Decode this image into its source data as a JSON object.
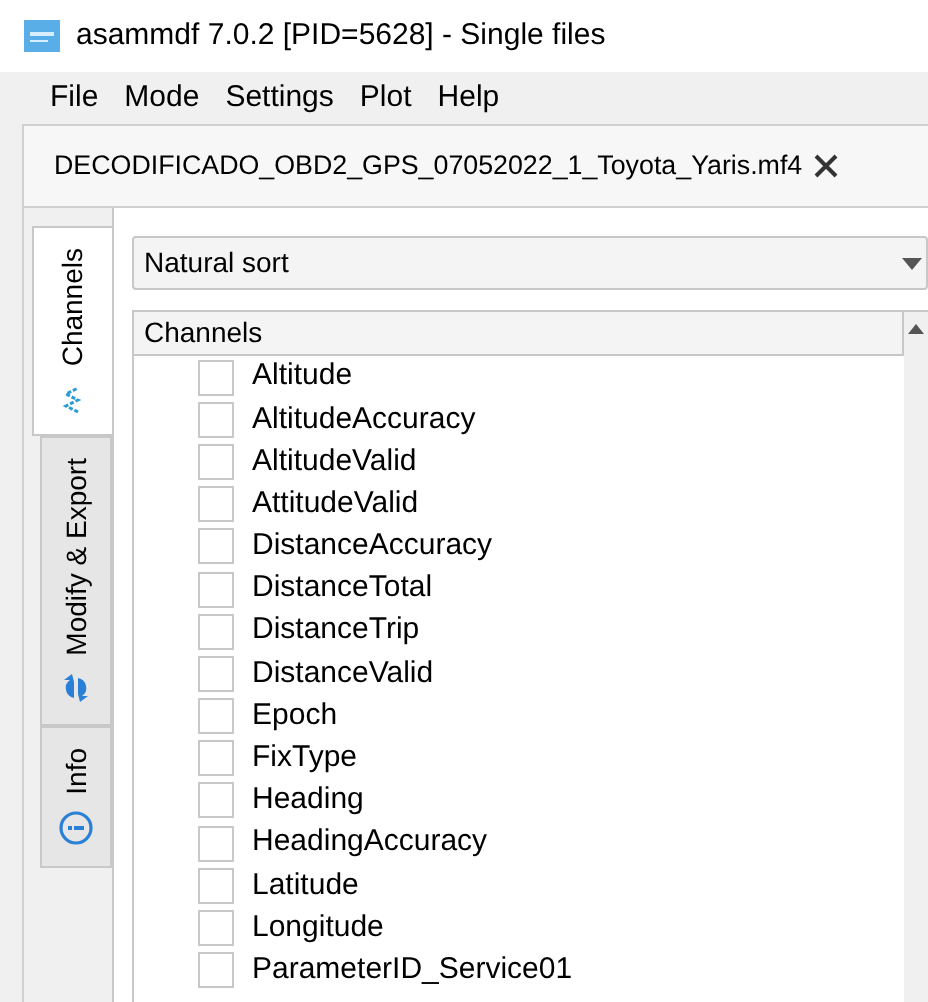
{
  "window": {
    "title": "asammdf 7.0.2 [PID=5628] - Single files"
  },
  "menu": [
    "File",
    "Mode",
    "Settings",
    "Plot",
    "Help"
  ],
  "file_tab": {
    "label": "DECODIFICADO_OBD2_GPS_07052022_1_Toyota_Yaris.mf4"
  },
  "side_tabs": [
    {
      "label": "Channels",
      "selected": true,
      "kind": "channels"
    },
    {
      "label": "Modify & Export",
      "selected": false,
      "kind": "modify"
    },
    {
      "label": "Info",
      "selected": false,
      "kind": "info"
    }
  ],
  "sort_combo": {
    "value": "Natural sort"
  },
  "tree": {
    "header": "Channels",
    "rows": [
      {
        "name": "Altitude",
        "checked": false
      },
      {
        "name": "AltitudeAccuracy",
        "checked": false
      },
      {
        "name": "AltitudeValid",
        "checked": false
      },
      {
        "name": "AttitudeValid",
        "checked": false
      },
      {
        "name": "DistanceAccuracy",
        "checked": false
      },
      {
        "name": "DistanceTotal",
        "checked": false
      },
      {
        "name": "DistanceTrip",
        "checked": false
      },
      {
        "name": "DistanceValid",
        "checked": false
      },
      {
        "name": "Epoch",
        "checked": false
      },
      {
        "name": "FixType",
        "checked": false
      },
      {
        "name": "Heading",
        "checked": false
      },
      {
        "name": "HeadingAccuracy",
        "checked": false
      },
      {
        "name": "Latitude",
        "checked": false
      },
      {
        "name": "Longitude",
        "checked": false
      },
      {
        "name": "ParameterID_Service01",
        "checked": false
      }
    ]
  }
}
